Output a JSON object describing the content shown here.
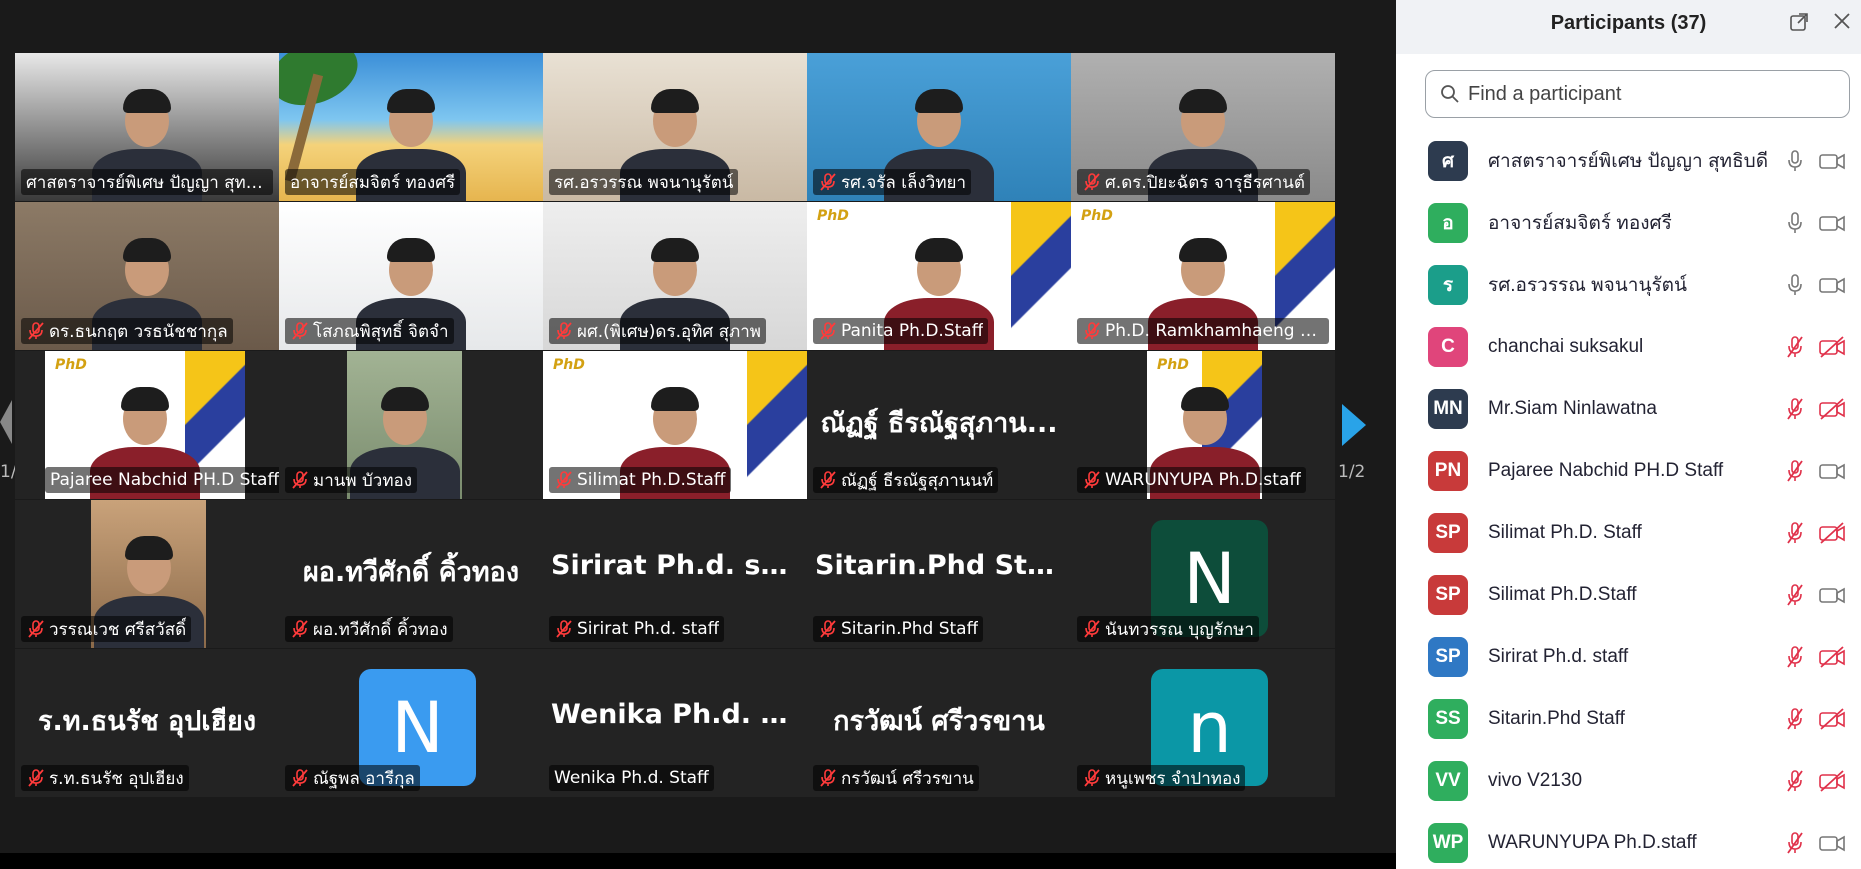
{
  "meeting": {
    "page_indicator": "1/2"
  },
  "tiles": [
    {
      "name": "ศาสตราจารย์พิเศษ ปัญญา สุทธิบดี",
      "muted": false,
      "kind": "video",
      "bg": "#3a3a3a",
      "accent": "#e8e8e8"
    },
    {
      "name": "อาจารย์สมจิตร์ ทองศรี",
      "muted": false,
      "kind": "beach",
      "active": true
    },
    {
      "name": "รศ.อรวรรณ พจนานุรัตน์",
      "muted": false,
      "kind": "video",
      "bg": "#c9b9a4",
      "accent": "#e9e1d4"
    },
    {
      "name": "รศ.จรัล เล็งวิทยา",
      "muted": true,
      "kind": "video",
      "bg": "#2f82b8",
      "accent": "#4aa0d8"
    },
    {
      "name": "ศ.ดร.ปิยะฉัตร จารุธีรศานต์",
      "muted": true,
      "kind": "video",
      "bg": "#8a8a8a",
      "accent": "#b0b0b0"
    },
    {
      "name": "ดร.ธนกฤต วรธนัชชากุล",
      "muted": true,
      "kind": "video",
      "bg": "#6b5a4a",
      "accent": "#8c7a66"
    },
    {
      "name": "โสภณพิสุทธิ์ จิตจำ",
      "muted": true,
      "kind": "video",
      "bg": "#e6e8ea",
      "accent": "#ffffff"
    },
    {
      "name": "ผศ.(พิเศษ)ดร.อุทิศ สุภาพ",
      "muted": true,
      "kind": "video",
      "bg": "#d7d7d7",
      "accent": "#eeeeee"
    },
    {
      "name": "Panita Ph.D.Staff",
      "muted": true,
      "kind": "phd",
      "bg": "#ffffff"
    },
    {
      "name": "Ph.D. Ramkhamhaeng Un...",
      "muted": true,
      "kind": "phd",
      "bg": "#ffffff"
    },
    {
      "name": "Pajaree Nabchid PH.D Staff",
      "muted": false,
      "kind": "phd",
      "bg": "#ffffff"
    },
    {
      "name": "มานพ บัวทอง",
      "muted": true,
      "kind": "video",
      "bg": "#7a8c6e",
      "accent": "#a2b394"
    },
    {
      "name": "Silimat Ph.D.Staff",
      "muted": true,
      "kind": "phd",
      "bg": "#ffffff"
    },
    {
      "name": "ณัฏฐ์ ธีรณัฐสุภานนท์",
      "muted": true,
      "kind": "text",
      "big": "ณัฏฐ์ ธีรณัฐสุภาน..."
    },
    {
      "name": "WARUNYUPA Ph.D.staff",
      "muted": true,
      "kind": "phd",
      "bg": "#ffffff"
    },
    {
      "name": "วรรณเวช ศรีสวัสดิ์",
      "muted": true,
      "kind": "video",
      "bg": "#8b6a4a",
      "accent": "#c9a27a"
    },
    {
      "name": "ผอ.ทวีศักดิ์ คิ้วทอง",
      "muted": true,
      "kind": "text",
      "big": "ผอ.ทวีศักดิ์ คิ้วทอง"
    },
    {
      "name": "Sirirat Ph.d. staff",
      "muted": true,
      "kind": "text",
      "big": "Sirirat Ph.d. staff"
    },
    {
      "name": "Sitarin.Phd Staff",
      "muted": true,
      "kind": "text",
      "big": "Sitarin.Phd Staff"
    },
    {
      "name": "นันทวรรณ บุญรักษา",
      "muted": true,
      "kind": "avatar",
      "letter": "N",
      "color": "#0d4d3a"
    },
    {
      "name": "ร.ท.ธนรัช อุปเฮียง",
      "muted": true,
      "kind": "text",
      "big": "ร.ท.ธนรัช อุปเฮียง"
    },
    {
      "name": "ณัฐพล อารีกุล",
      "muted": true,
      "kind": "avatar",
      "letter": "N",
      "color": "#3a9bf0"
    },
    {
      "name": "Wenika Ph.d. Staff",
      "muted": false,
      "kind": "text",
      "big": "Wenika Ph.d. St..."
    },
    {
      "name": "กรวัฒน์ ศรีวรขาน",
      "muted": true,
      "kind": "text",
      "big": "กรวัฒน์ ศรีวรขาน"
    },
    {
      "name": "หนูเพชร จำปาทอง",
      "muted": true,
      "kind": "avatar",
      "letter": "n",
      "color": "#0b97a6"
    }
  ],
  "panel": {
    "title": "Participants (37)",
    "search_placeholder": "Find a participant",
    "participants": [
      {
        "initials": "ศ",
        "name": "ศาสตราจารย์พิเศษ ปัญญา สุทธิบดี",
        "color": "#2d3b4f",
        "mic": "on",
        "cam": "on"
      },
      {
        "initials": "อ",
        "name": "อาจารย์สมจิตร์ ทองศรี",
        "color": "#2fae5e",
        "mic": "on",
        "cam": "on"
      },
      {
        "initials": "ร",
        "name": "รศ.อรวรรณ พจนานุรัตน์",
        "color": "#1b9e8a",
        "mic": "on",
        "cam": "on"
      },
      {
        "initials": "C",
        "name": "chanchai suksakul",
        "color": "#e0457b",
        "mic": "off",
        "cam": "off"
      },
      {
        "initials": "MN",
        "name": "Mr.Siam Ninlawatna",
        "color": "#2d3b4f",
        "mic": "off",
        "cam": "off"
      },
      {
        "initials": "PN",
        "name": "Pajaree Nabchid PH.D Staff",
        "color": "#c83a3a",
        "mic": "off",
        "cam": "on"
      },
      {
        "initials": "SP",
        "name": "Silimat Ph.D. Staff",
        "color": "#c83a3a",
        "mic": "off",
        "cam": "off"
      },
      {
        "initials": "SP",
        "name": "Silimat Ph.D.Staff",
        "color": "#c83a3a",
        "mic": "off",
        "cam": "on"
      },
      {
        "initials": "SP",
        "name": "Sirirat Ph.d. staff",
        "color": "#2f78c4",
        "mic": "off",
        "cam": "off"
      },
      {
        "initials": "SS",
        "name": "Sitarin.Phd Staff",
        "color": "#2fae5e",
        "mic": "off",
        "cam": "off"
      },
      {
        "initials": "VV",
        "name": "vivo V2130",
        "color": "#2fae5e",
        "mic": "off",
        "cam": "off"
      },
      {
        "initials": "WP",
        "name": "WARUNYUPA Ph.D.staff",
        "color": "#2fae5e",
        "mic": "off",
        "cam": "on"
      }
    ]
  }
}
